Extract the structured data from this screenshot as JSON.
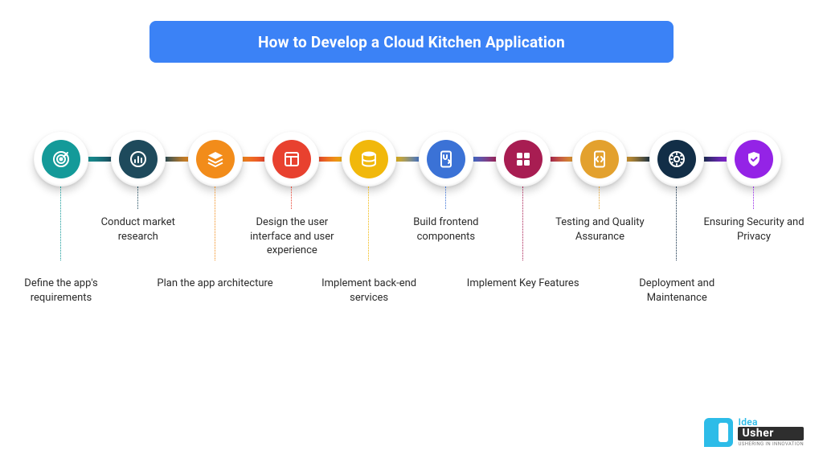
{
  "title": "How to Develop a  Cloud Kitchen Application",
  "steps": [
    {
      "label": "Define the app's requirements",
      "color": "#149A99",
      "icon": "target",
      "labelPos": "down"
    },
    {
      "label": "Conduct market research",
      "color": "#1E4A5C",
      "icon": "chart",
      "labelPos": "up"
    },
    {
      "label": "Plan the app architecture",
      "color": "#F28C1A",
      "icon": "layers",
      "labelPos": "down"
    },
    {
      "label": "Design the user interface and user experience",
      "color": "#E8412F",
      "icon": "layout",
      "labelPos": "up"
    },
    {
      "label": "Implement back-end services",
      "color": "#F1B80B",
      "icon": "database",
      "labelPos": "down"
    },
    {
      "label": "Build frontend components",
      "color": "#3B72D6",
      "icon": "ux",
      "labelPos": "up"
    },
    {
      "label": "Implement Key Features",
      "color": "#A81D52",
      "icon": "apps",
      "labelPos": "down"
    },
    {
      "label": "Testing and Quality Assurance",
      "color": "#E3A12E",
      "icon": "code",
      "labelPos": "up"
    },
    {
      "label": "Deployment and Maintenance",
      "color": "#122E47",
      "icon": "gear",
      "labelPos": "down"
    },
    {
      "label": "Ensuring Security and Privacy",
      "color": "#9423E6",
      "icon": "shield",
      "labelPos": "up"
    }
  ],
  "logo": {
    "top": "Idea",
    "bottom": "Usher",
    "tagline": "USHERING IN INNOVATION"
  }
}
